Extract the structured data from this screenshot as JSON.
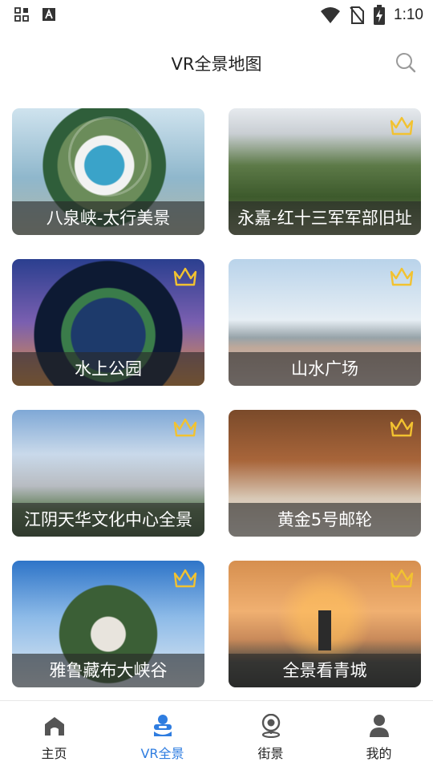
{
  "status_bar": {
    "time": "1:10",
    "left_icons": [
      "apps-icon",
      "a-icon"
    ],
    "right_icons": [
      "wifi-icon",
      "no-sim-icon",
      "battery-charging-icon"
    ]
  },
  "header": {
    "title": "VR全景地图",
    "search_icon": "search-icon"
  },
  "cards": [
    {
      "title": "八泉峡-太行美景",
      "crown": false
    },
    {
      "title": "永嘉-红十三军军部旧址",
      "crown": true
    },
    {
      "title": "水上公园",
      "crown": true
    },
    {
      "title": "山水广场",
      "crown": true
    },
    {
      "title": "江阴天华文化中心全景",
      "crown": true
    },
    {
      "title": "黄金5号邮轮",
      "crown": true
    },
    {
      "title": "雅鲁藏布大峡谷",
      "crown": true
    },
    {
      "title": "全景看青城",
      "crown": true
    }
  ],
  "bottom_nav": [
    {
      "label": "主页",
      "icon": "home-icon",
      "active": false
    },
    {
      "label": "VR全景",
      "icon": "vr-icon",
      "active": true
    },
    {
      "label": "街景",
      "icon": "street-view-icon",
      "active": false
    },
    {
      "label": "我的",
      "icon": "user-icon",
      "active": false
    }
  ],
  "colors": {
    "accent": "#2f7de0",
    "crown": "#f2c230",
    "caption_bg": "rgba(40,40,40,0.62)"
  }
}
